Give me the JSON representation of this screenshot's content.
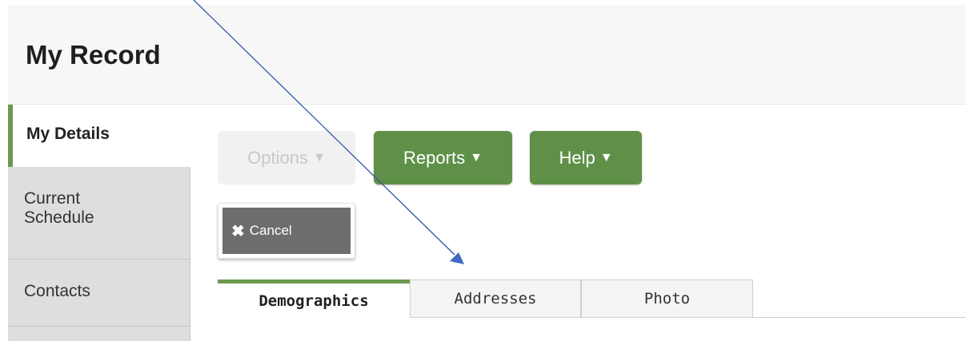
{
  "header": {
    "title": "My Record"
  },
  "sidebar": {
    "items": [
      {
        "label": "My Details",
        "active": true
      },
      {
        "label_line1": "Current",
        "label_line2": "Schedule",
        "active": false
      },
      {
        "label": "Contacts",
        "active": false
      },
      {
        "label": "",
        "active": false
      }
    ]
  },
  "toolbar": {
    "options_label": "Options",
    "reports_label": "Reports",
    "help_label": "Help",
    "cancel_label": "Cancel",
    "caret": "▼",
    "cancel_icon": "✖"
  },
  "tabs": [
    {
      "label": "Demographics",
      "active": true
    },
    {
      "label": "Addresses",
      "active": false
    },
    {
      "label": "Photo",
      "active": false
    }
  ],
  "colors": {
    "accent_green": "#6a9a4f",
    "button_green": "#5f9048",
    "annotation_arrow": "#2e56a8"
  },
  "annotation": {
    "icon": "pointer-arrow-icon"
  }
}
